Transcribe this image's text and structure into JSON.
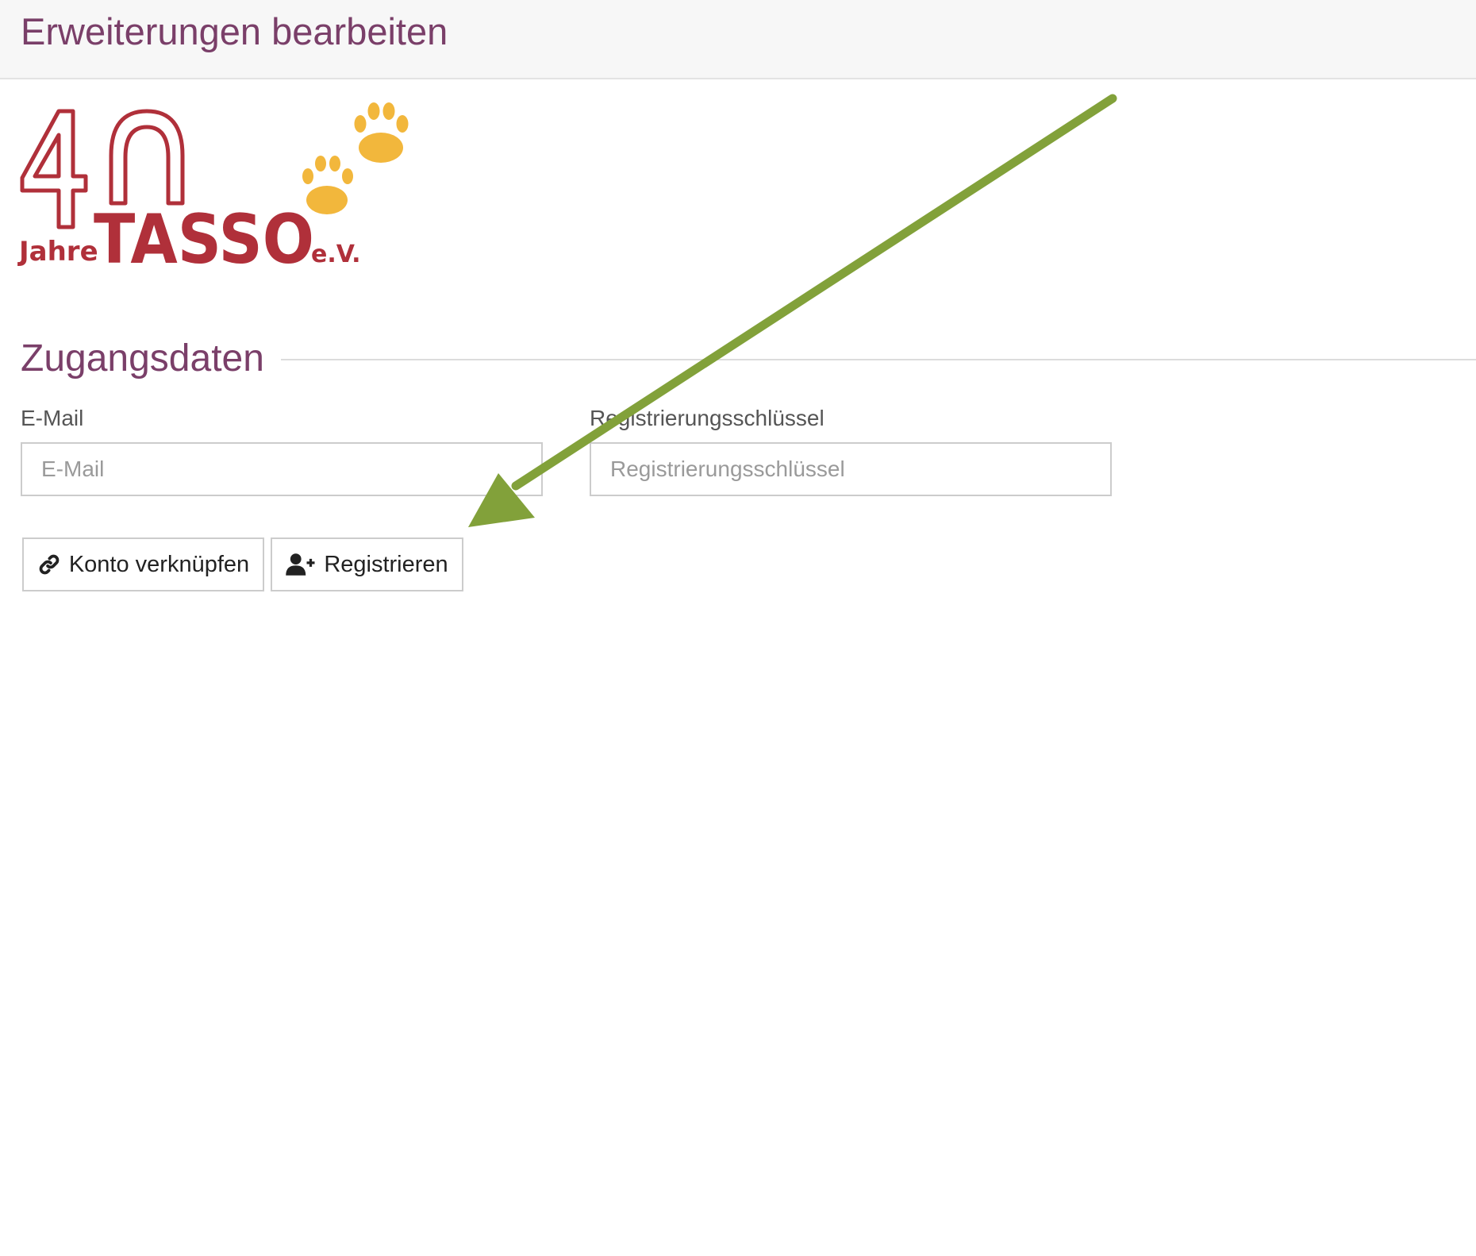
{
  "header": {
    "title": "Erweiterungen bearbeiten"
  },
  "logo": {
    "number": "4",
    "word": "TASSO",
    "prefix": "Jahre",
    "suffix": "e.V.",
    "colors": {
      "red": "#b0303a",
      "paw": "#f2b73c"
    }
  },
  "section": {
    "title": "Zugangsdaten"
  },
  "form": {
    "email": {
      "label": "E-Mail",
      "placeholder": "E-Mail",
      "value": ""
    },
    "key": {
      "label": "Registrierungsschlüssel",
      "placeholder": "Registrierungsschlüssel",
      "value": ""
    }
  },
  "buttons": {
    "link_account": {
      "label": "Konto verknüpfen",
      "icon": "link-icon"
    },
    "register": {
      "label": "Registrieren",
      "icon": "user-plus-icon"
    }
  },
  "annotation": {
    "type": "arrow",
    "color": "#82a13a"
  },
  "colors": {
    "accent": "#7a3f69",
    "border": "#cccccc",
    "header_bg": "#f7f7f7"
  }
}
